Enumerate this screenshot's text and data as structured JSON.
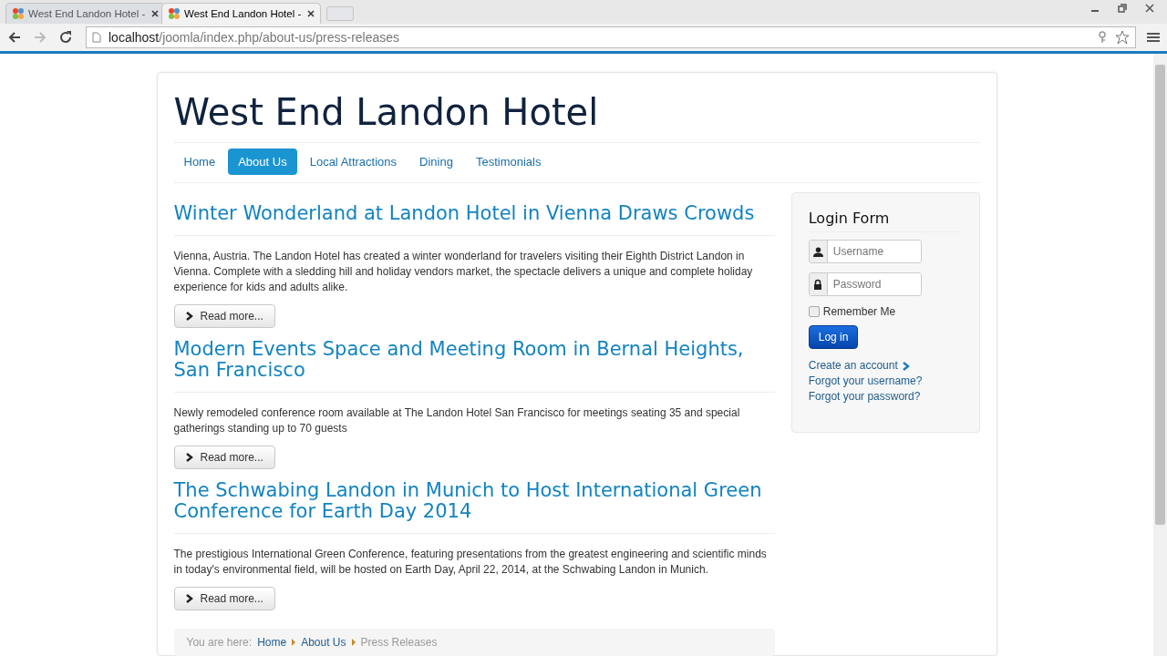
{
  "browser": {
    "tabs": [
      {
        "title": "West End Landon Hotel -",
        "selected": false
      },
      {
        "title": "West End Landon Hotel -",
        "selected": true
      }
    ],
    "url_host": "localhost",
    "url_path": "/joomla/index.php/about-us/press-releases"
  },
  "site": {
    "title": "West End Landon Hotel",
    "nav": [
      {
        "label": "Home",
        "selected": false
      },
      {
        "label": "About Us",
        "selected": true
      },
      {
        "label": "Local Attractions",
        "selected": false
      },
      {
        "label": "Dining",
        "selected": false
      },
      {
        "label": "Testimonials",
        "selected": false
      }
    ]
  },
  "articles": [
    {
      "title": "Winter Wonderland at Landon Hotel in Vienna Draws Crowds",
      "body": "Vienna, Austria. The Landon Hotel has created a winter wonderland for travelers visiting their Eighth District Landon in Vienna. Complete with a sledding hill and holiday vendors market, the spectacle delivers a unique and complete holiday experience for kids and adults alike.",
      "button": "Read more..."
    },
    {
      "title": "Modern Events Space and Meeting Room in Bernal Heights, San Francisco",
      "body": "Newly remodeled conference room available at The Landon Hotel San Francisco for meetings seating 35 and special gatherings standing up to 70 guests",
      "button": "Read more..."
    },
    {
      "title": "The Schwabing Landon in Munich to Host International Green Conference for Earth Day 2014",
      "body": "The prestigious International Green Conference, featuring presentations from the greatest engineering and scientific minds in today's environmental field, will be hosted on Earth Day, April 22, 2014, at the Schwabing Landon in Munich.",
      "button": "Read more..."
    }
  ],
  "breadcrumb": {
    "label": "You are here:",
    "links": [
      "Home",
      "About Us"
    ],
    "current": "Press Releases"
  },
  "login": {
    "title": "Login Form",
    "username_placeholder": "Username",
    "password_placeholder": "Password",
    "remember": {
      "label": "Remember Me",
      "checked": false
    },
    "button": "Log in",
    "links": [
      "Create an account",
      "Forgot your username?",
      "Forgot your password?"
    ]
  }
}
